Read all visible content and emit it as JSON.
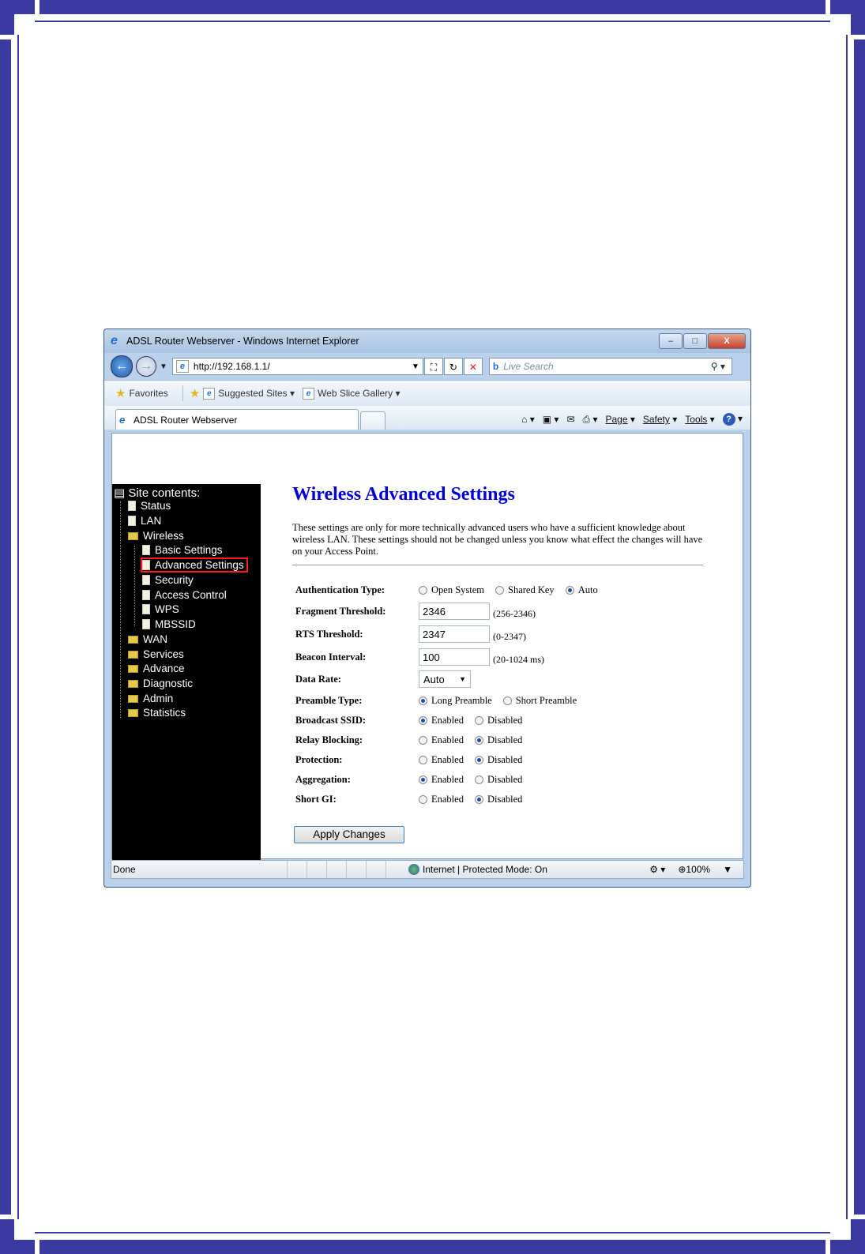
{
  "window": {
    "title": "ADSL Router Webserver - Windows Internet Explorer",
    "minimize": "–",
    "maximize": "□",
    "close": "X"
  },
  "address": {
    "url": "http://192.168.1.1/",
    "search_placeholder": "Live Search"
  },
  "favorites_bar": {
    "favorites": "Favorites",
    "suggested_sites": "Suggested Sites",
    "web_slice_gallery": "Web Slice Gallery"
  },
  "tab": {
    "title": "ADSL Router Webserver"
  },
  "command_bar": {
    "page": "Page",
    "safety": "Safety",
    "tools": "Tools"
  },
  "sidebar": {
    "title": "Site contents:",
    "items": [
      {
        "label": "Status"
      },
      {
        "label": "LAN"
      },
      {
        "label": "Wireless"
      },
      {
        "label": "Basic Settings"
      },
      {
        "label": "Advanced Settings"
      },
      {
        "label": "Security"
      },
      {
        "label": "Access Control"
      },
      {
        "label": "WPS"
      },
      {
        "label": "MBSSID"
      },
      {
        "label": "WAN"
      },
      {
        "label": "Services"
      },
      {
        "label": "Advance"
      },
      {
        "label": "Diagnostic"
      },
      {
        "label": "Admin"
      },
      {
        "label": "Statistics"
      }
    ]
  },
  "main": {
    "title": "Wireless Advanced Settings",
    "description": "These settings are only for more technically advanced users who have a sufficient knowledge about wireless LAN. These settings should not be changed unless you know what effect the changes will have on your Access Point.",
    "auth_type": {
      "label": "Authentication Type:",
      "opt1": "Open System",
      "opt2": "Shared Key",
      "opt3": "Auto"
    },
    "fragment": {
      "label": "Fragment Threshold:",
      "value": "2346",
      "hint": "(256-2346)"
    },
    "rts": {
      "label": "RTS Threshold:",
      "value": "2347",
      "hint": "(0-2347)"
    },
    "beacon": {
      "label": "Beacon Interval:",
      "value": "100",
      "hint": "(20-1024 ms)"
    },
    "data_rate": {
      "label": "Data Rate:",
      "value": "Auto"
    },
    "preamble": {
      "label": "Preamble Type:",
      "opt1": "Long Preamble",
      "opt2": "Short Preamble"
    },
    "broadcast_ssid": {
      "label": "Broadcast SSID:"
    },
    "relay_blocking": {
      "label": "Relay Blocking:"
    },
    "protection": {
      "label": "Protection:"
    },
    "aggregation": {
      "label": "Aggregation:"
    },
    "short_gi": {
      "label": "Short GI:"
    },
    "enabled": "Enabled",
    "disabled": "Disabled",
    "apply": "Apply Changes"
  },
  "status_bar": {
    "status": "Done",
    "zone": "Internet | Protected Mode: On",
    "zoom": "100%"
  }
}
